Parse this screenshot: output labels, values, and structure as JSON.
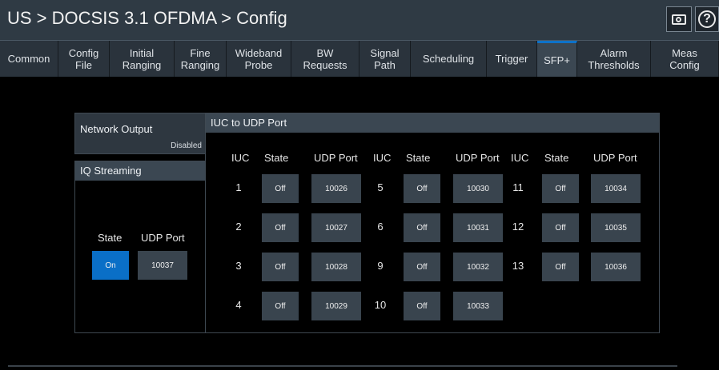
{
  "title": "US > DOCSIS 3.1 OFDMA > Config",
  "toolbar": {
    "camera_icon": "camera-icon",
    "help_icon": "help-icon",
    "help_glyph": "?"
  },
  "tabs": [
    {
      "label": "Common"
    },
    {
      "label": "Config\nFile"
    },
    {
      "label": "Initial\nRanging"
    },
    {
      "label": "Fine\nRanging"
    },
    {
      "label": "Wideband\nProbe"
    },
    {
      "label": "BW\nRequests"
    },
    {
      "label": "Signal\nPath"
    },
    {
      "label": "Scheduling"
    },
    {
      "label": "Trigger"
    },
    {
      "label": "SFP+",
      "active": true
    },
    {
      "label": "Alarm\nThresholds"
    },
    {
      "label": "Meas\nConfig"
    }
  ],
  "network_output": {
    "label": "Network Output",
    "value": "Disabled"
  },
  "iq_streaming": {
    "title": "IQ Streaming",
    "state_header": "State",
    "port_header": "UDP Port",
    "state": "On",
    "port": "10037"
  },
  "iuc_panel": {
    "title": "IUC to UDP Port",
    "headers": {
      "iuc": "IUC",
      "state": "State",
      "port": "UDP Port"
    },
    "columns": [
      [
        {
          "iuc": "1",
          "state": "Off",
          "port": "10026"
        },
        {
          "iuc": "2",
          "state": "Off",
          "port": "10027"
        },
        {
          "iuc": "3",
          "state": "Off",
          "port": "10028"
        },
        {
          "iuc": "4",
          "state": "Off",
          "port": "10029"
        }
      ],
      [
        {
          "iuc": "5",
          "state": "Off",
          "port": "10030"
        },
        {
          "iuc": "6",
          "state": "Off",
          "port": "10031"
        },
        {
          "iuc": "9",
          "state": "Off",
          "port": "10032"
        },
        {
          "iuc": "10",
          "state": "Off",
          "port": "10033"
        }
      ],
      [
        {
          "iuc": "11",
          "state": "Off",
          "port": "10034"
        },
        {
          "iuc": "12",
          "state": "Off",
          "port": "10035"
        },
        {
          "iuc": "13",
          "state": "Off",
          "port": "10036"
        }
      ]
    ]
  },
  "colors": {
    "accent": "#0a6fc7",
    "tab_bar": "#2a333c",
    "panel_head": "#3b4752"
  }
}
